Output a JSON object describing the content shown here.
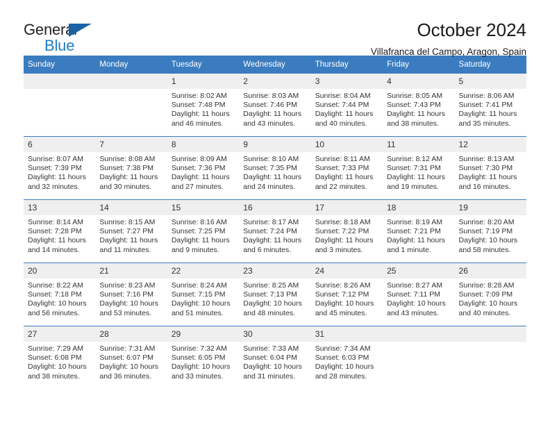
{
  "brand": {
    "line1": "General",
    "line2": "Blue",
    "triangle_color": "#1763a6",
    "blue_text_color": "#1f7ec2"
  },
  "header": {
    "title": "October 2024",
    "subtitle": "Villafranca del Campo, Aragon, Spain"
  },
  "theme": {
    "header_blue": "#3a7cbf",
    "day_band_gray": "#efefef",
    "text": "#333333"
  },
  "weekdays": [
    "Sunday",
    "Monday",
    "Tuesday",
    "Wednesday",
    "Thursday",
    "Friday",
    "Saturday"
  ],
  "weeks": [
    [
      {
        "day": "",
        "sunrise": "",
        "sunset": "",
        "daylight1": "",
        "daylight2": ""
      },
      {
        "day": "",
        "sunrise": "",
        "sunset": "",
        "daylight1": "",
        "daylight2": ""
      },
      {
        "day": "1",
        "sunrise": "Sunrise: 8:02 AM",
        "sunset": "Sunset: 7:48 PM",
        "daylight1": "Daylight: 11 hours",
        "daylight2": "and 46 minutes."
      },
      {
        "day": "2",
        "sunrise": "Sunrise: 8:03 AM",
        "sunset": "Sunset: 7:46 PM",
        "daylight1": "Daylight: 11 hours",
        "daylight2": "and 43 minutes."
      },
      {
        "day": "3",
        "sunrise": "Sunrise: 8:04 AM",
        "sunset": "Sunset: 7:44 PM",
        "daylight1": "Daylight: 11 hours",
        "daylight2": "and 40 minutes."
      },
      {
        "day": "4",
        "sunrise": "Sunrise: 8:05 AM",
        "sunset": "Sunset: 7:43 PM",
        "daylight1": "Daylight: 11 hours",
        "daylight2": "and 38 minutes."
      },
      {
        "day": "5",
        "sunrise": "Sunrise: 8:06 AM",
        "sunset": "Sunset: 7:41 PM",
        "daylight1": "Daylight: 11 hours",
        "daylight2": "and 35 minutes."
      }
    ],
    [
      {
        "day": "6",
        "sunrise": "Sunrise: 8:07 AM",
        "sunset": "Sunset: 7:39 PM",
        "daylight1": "Daylight: 11 hours",
        "daylight2": "and 32 minutes."
      },
      {
        "day": "7",
        "sunrise": "Sunrise: 8:08 AM",
        "sunset": "Sunset: 7:38 PM",
        "daylight1": "Daylight: 11 hours",
        "daylight2": "and 30 minutes."
      },
      {
        "day": "8",
        "sunrise": "Sunrise: 8:09 AM",
        "sunset": "Sunset: 7:36 PM",
        "daylight1": "Daylight: 11 hours",
        "daylight2": "and 27 minutes."
      },
      {
        "day": "9",
        "sunrise": "Sunrise: 8:10 AM",
        "sunset": "Sunset: 7:35 PM",
        "daylight1": "Daylight: 11 hours",
        "daylight2": "and 24 minutes."
      },
      {
        "day": "10",
        "sunrise": "Sunrise: 8:11 AM",
        "sunset": "Sunset: 7:33 PM",
        "daylight1": "Daylight: 11 hours",
        "daylight2": "and 22 minutes."
      },
      {
        "day": "11",
        "sunrise": "Sunrise: 8:12 AM",
        "sunset": "Sunset: 7:31 PM",
        "daylight1": "Daylight: 11 hours",
        "daylight2": "and 19 minutes."
      },
      {
        "day": "12",
        "sunrise": "Sunrise: 8:13 AM",
        "sunset": "Sunset: 7:30 PM",
        "daylight1": "Daylight: 11 hours",
        "daylight2": "and 16 minutes."
      }
    ],
    [
      {
        "day": "13",
        "sunrise": "Sunrise: 8:14 AM",
        "sunset": "Sunset: 7:28 PM",
        "daylight1": "Daylight: 11 hours",
        "daylight2": "and 14 minutes."
      },
      {
        "day": "14",
        "sunrise": "Sunrise: 8:15 AM",
        "sunset": "Sunset: 7:27 PM",
        "daylight1": "Daylight: 11 hours",
        "daylight2": "and 11 minutes."
      },
      {
        "day": "15",
        "sunrise": "Sunrise: 8:16 AM",
        "sunset": "Sunset: 7:25 PM",
        "daylight1": "Daylight: 11 hours",
        "daylight2": "and 9 minutes."
      },
      {
        "day": "16",
        "sunrise": "Sunrise: 8:17 AM",
        "sunset": "Sunset: 7:24 PM",
        "daylight1": "Daylight: 11 hours",
        "daylight2": "and 6 minutes."
      },
      {
        "day": "17",
        "sunrise": "Sunrise: 8:18 AM",
        "sunset": "Sunset: 7:22 PM",
        "daylight1": "Daylight: 11 hours",
        "daylight2": "and 3 minutes."
      },
      {
        "day": "18",
        "sunrise": "Sunrise: 8:19 AM",
        "sunset": "Sunset: 7:21 PM",
        "daylight1": "Daylight: 11 hours",
        "daylight2": "and 1 minute."
      },
      {
        "day": "19",
        "sunrise": "Sunrise: 8:20 AM",
        "sunset": "Sunset: 7:19 PM",
        "daylight1": "Daylight: 10 hours",
        "daylight2": "and 58 minutes."
      }
    ],
    [
      {
        "day": "20",
        "sunrise": "Sunrise: 8:22 AM",
        "sunset": "Sunset: 7:18 PM",
        "daylight1": "Daylight: 10 hours",
        "daylight2": "and 56 minutes."
      },
      {
        "day": "21",
        "sunrise": "Sunrise: 8:23 AM",
        "sunset": "Sunset: 7:16 PM",
        "daylight1": "Daylight: 10 hours",
        "daylight2": "and 53 minutes."
      },
      {
        "day": "22",
        "sunrise": "Sunrise: 8:24 AM",
        "sunset": "Sunset: 7:15 PM",
        "daylight1": "Daylight: 10 hours",
        "daylight2": "and 51 minutes."
      },
      {
        "day": "23",
        "sunrise": "Sunrise: 8:25 AM",
        "sunset": "Sunset: 7:13 PM",
        "daylight1": "Daylight: 10 hours",
        "daylight2": "and 48 minutes."
      },
      {
        "day": "24",
        "sunrise": "Sunrise: 8:26 AM",
        "sunset": "Sunset: 7:12 PM",
        "daylight1": "Daylight: 10 hours",
        "daylight2": "and 45 minutes."
      },
      {
        "day": "25",
        "sunrise": "Sunrise: 8:27 AM",
        "sunset": "Sunset: 7:11 PM",
        "daylight1": "Daylight: 10 hours",
        "daylight2": "and 43 minutes."
      },
      {
        "day": "26",
        "sunrise": "Sunrise: 8:28 AM",
        "sunset": "Sunset: 7:09 PM",
        "daylight1": "Daylight: 10 hours",
        "daylight2": "and 40 minutes."
      }
    ],
    [
      {
        "day": "27",
        "sunrise": "Sunrise: 7:29 AM",
        "sunset": "Sunset: 6:08 PM",
        "daylight1": "Daylight: 10 hours",
        "daylight2": "and 38 minutes."
      },
      {
        "day": "28",
        "sunrise": "Sunrise: 7:31 AM",
        "sunset": "Sunset: 6:07 PM",
        "daylight1": "Daylight: 10 hours",
        "daylight2": "and 36 minutes."
      },
      {
        "day": "29",
        "sunrise": "Sunrise: 7:32 AM",
        "sunset": "Sunset: 6:05 PM",
        "daylight1": "Daylight: 10 hours",
        "daylight2": "and 33 minutes."
      },
      {
        "day": "30",
        "sunrise": "Sunrise: 7:33 AM",
        "sunset": "Sunset: 6:04 PM",
        "daylight1": "Daylight: 10 hours",
        "daylight2": "and 31 minutes."
      },
      {
        "day": "31",
        "sunrise": "Sunrise: 7:34 AM",
        "sunset": "Sunset: 6:03 PM",
        "daylight1": "Daylight: 10 hours",
        "daylight2": "and 28 minutes."
      },
      {
        "day": "",
        "sunrise": "",
        "sunset": "",
        "daylight1": "",
        "daylight2": ""
      },
      {
        "day": "",
        "sunrise": "",
        "sunset": "",
        "daylight1": "",
        "daylight2": ""
      }
    ]
  ]
}
